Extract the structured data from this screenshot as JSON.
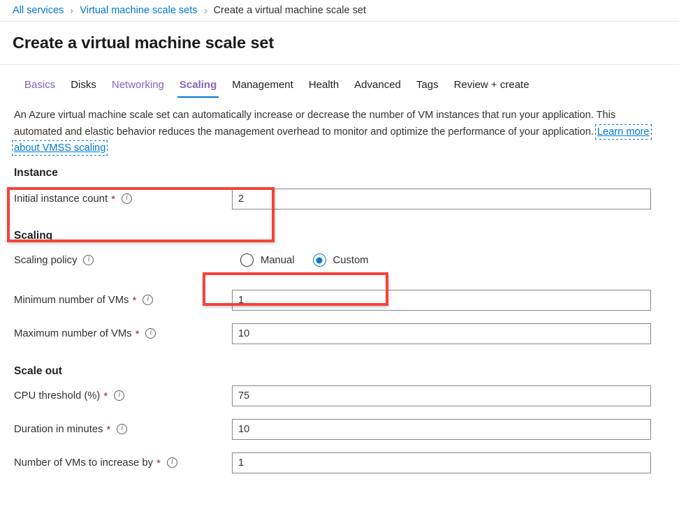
{
  "breadcrumb": {
    "items": [
      {
        "label": "All services",
        "type": "link"
      },
      {
        "label": "Virtual machine scale sets",
        "type": "link"
      },
      {
        "label": "Create a virtual machine scale set",
        "type": "current"
      }
    ],
    "separator": "›"
  },
  "header": {
    "title": "Create a virtual machine scale set"
  },
  "tabs": [
    {
      "label": "Basics",
      "state": "visited"
    },
    {
      "label": "Disks",
      "state": "default"
    },
    {
      "label": "Networking",
      "state": "visited"
    },
    {
      "label": "Scaling",
      "state": "active"
    },
    {
      "label": "Management",
      "state": "default"
    },
    {
      "label": "Health",
      "state": "default"
    },
    {
      "label": "Advanced",
      "state": "default"
    },
    {
      "label": "Tags",
      "state": "default"
    },
    {
      "label": "Review + create",
      "state": "default"
    }
  ],
  "description": {
    "text": "An Azure virtual machine scale set can automatically increase or decrease the number of VM instances that run your application. This automated and elastic behavior reduces the management overhead to monitor and optimize the performance of your application.",
    "link_label": "Learn more about VMSS scaling"
  },
  "instance_section": {
    "heading": "Instance",
    "initial_instance_count": {
      "label": "Initial instance count",
      "required": "*",
      "info_icon": "info-icon",
      "value": "2"
    }
  },
  "scaling_section": {
    "heading": "Scaling",
    "scaling_policy": {
      "label": "Scaling policy",
      "info_icon": "info-icon",
      "options": [
        {
          "label": "Manual",
          "selected": false
        },
        {
          "label": "Custom",
          "selected": true
        }
      ]
    },
    "minimum_vms": {
      "label": "Minimum number of VMs",
      "required": "*",
      "info_icon": "info-icon",
      "value": "1"
    },
    "maximum_vms": {
      "label": "Maximum number of VMs",
      "required": "*",
      "info_icon": "info-icon",
      "value": "10"
    }
  },
  "scale_out_section": {
    "heading": "Scale out",
    "cpu_threshold": {
      "label": "CPU threshold (%)",
      "required": "*",
      "info_icon": "info-icon",
      "value": "75"
    },
    "duration_minutes": {
      "label": "Duration in minutes",
      "required": "*",
      "info_icon": "info-icon",
      "value": "10"
    },
    "vms_increase_by": {
      "label": "Number of VMs to increase by",
      "required": "*",
      "info_icon": "info-icon",
      "value": "1"
    }
  },
  "annotations": {
    "color": "#f4433a",
    "boxes": [
      {
        "name": "instance-section-highlight"
      },
      {
        "name": "scaling-policy-highlight"
      }
    ]
  },
  "colors": {
    "link": "#0078d4",
    "tab_visited": "#8764b8",
    "tab_active_underline": "#0078d4",
    "required_asterisk": "#a4262c",
    "annotation": "#f4433a",
    "radio_selected": "#0078d4"
  }
}
